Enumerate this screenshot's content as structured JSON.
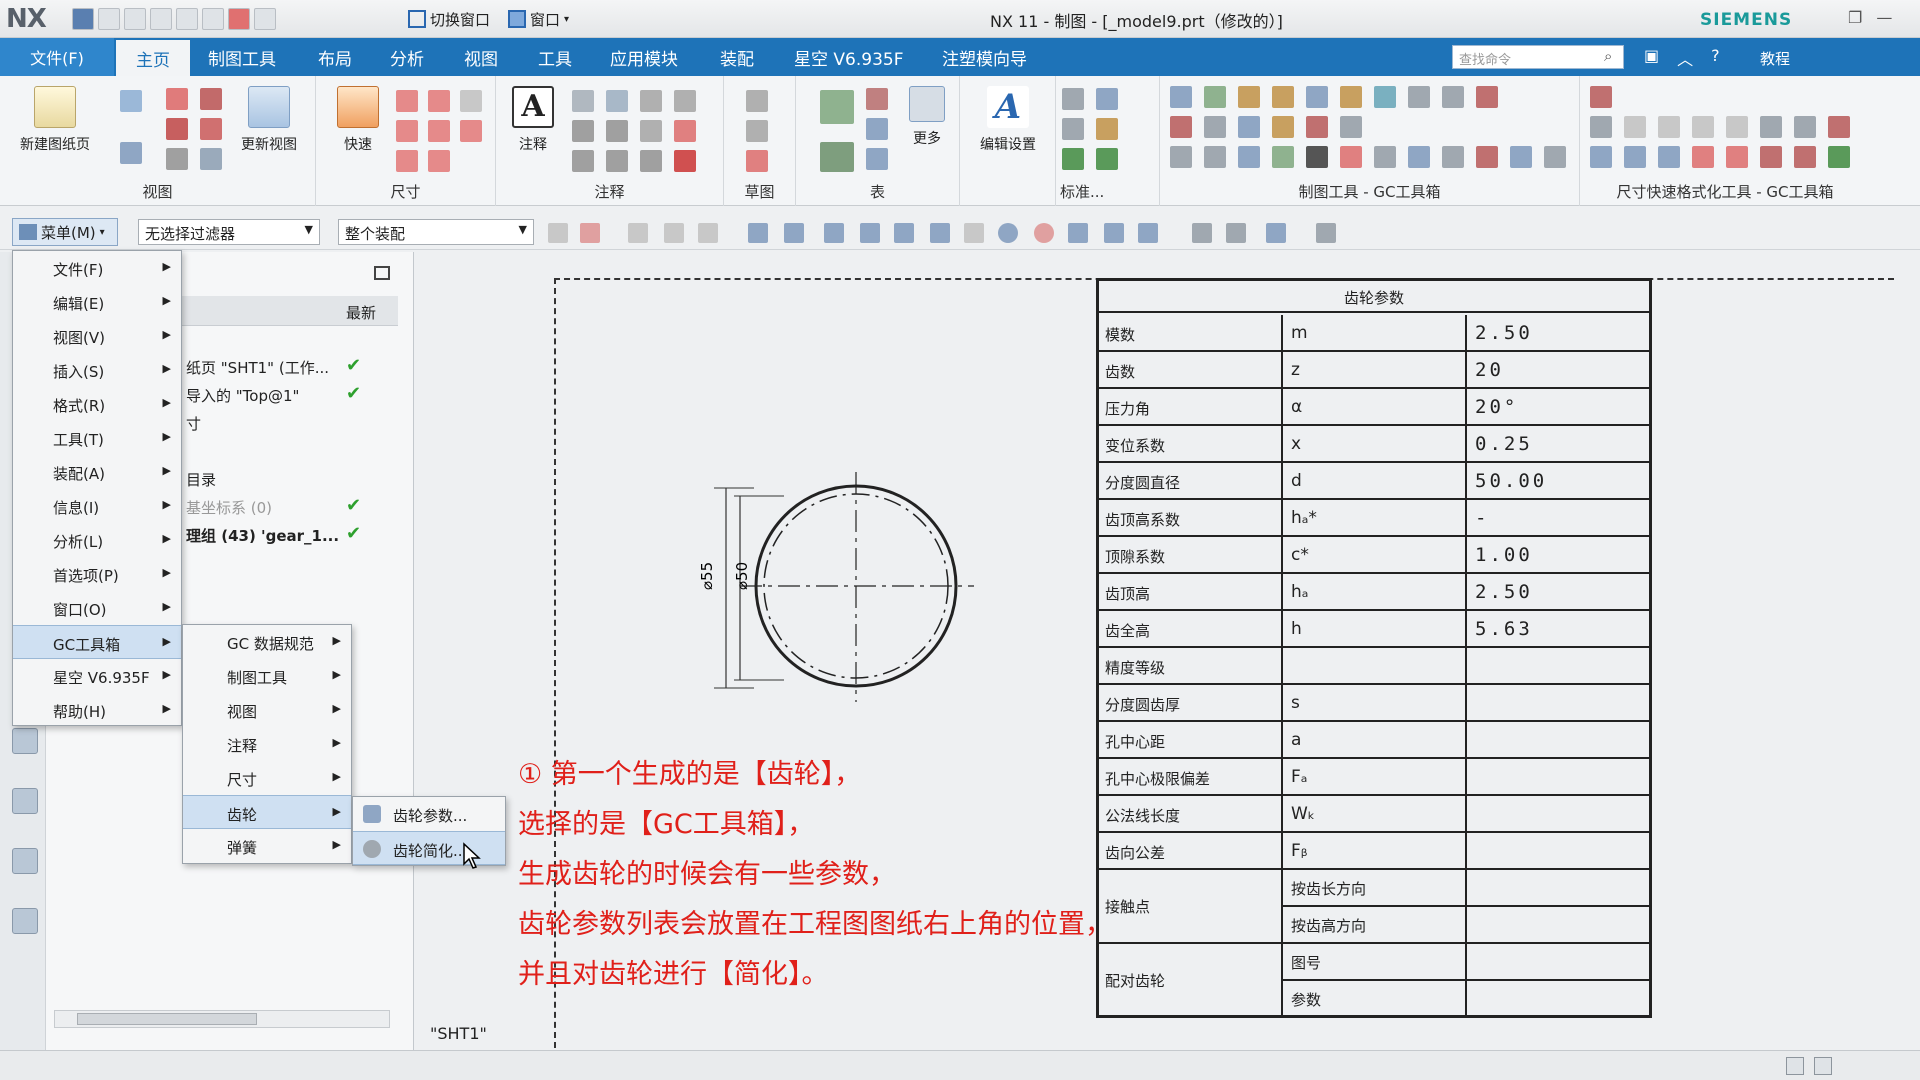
{
  "window": {
    "logo": "NX",
    "title": "NX 11 - 制图 - [_model9.prt（修改的）]",
    "brand": "SIEMENS",
    "switch_window": "切换窗口",
    "window_menu": "窗口"
  },
  "tabs": {
    "file": "文件(F)",
    "items": [
      "主页",
      "制图工具",
      "布局",
      "分析",
      "视图",
      "工具",
      "应用模块",
      "装配",
      "星空 V6.935F",
      "注塑模向导"
    ],
    "active": "主页",
    "search_placeholder": "查找命令",
    "help": "教程"
  },
  "ribbon": {
    "new_sheet": "新建图纸页",
    "update_views": "更新视图",
    "quick": "快速",
    "annotation": "注释",
    "more": "更多",
    "edit_settings": "编辑设置",
    "groups": [
      "视图",
      "尺寸",
      "注释",
      "草图",
      "表",
      "标准...",
      "制图工具 - GC工具箱",
      "尺寸快速格式化工具 - GC工具箱"
    ]
  },
  "toolbar": {
    "menu": "菜单(M)",
    "filter": "无选择过滤器",
    "scope": "整个装配"
  },
  "nav": {
    "col_latest": "最新",
    "rows": [
      {
        "text": "纸页 \"SHT1\" (工作...",
        "check": true
      },
      {
        "text": "导入的 \"Top@1\"",
        "check": true
      },
      {
        "text": "寸",
        "check": false
      },
      {
        "text": "",
        "check": false
      },
      {
        "text": "目录",
        "check": false
      },
      {
        "text": "基坐标系 (0)",
        "check": true
      },
      {
        "text": "理组 (43) 'gear_1...",
        "check": true
      }
    ]
  },
  "menu_main": {
    "items": [
      "文件(F)",
      "编辑(E)",
      "视图(V)",
      "插入(S)",
      "格式(R)",
      "工具(T)",
      "装配(A)",
      "信息(I)",
      "分析(L)",
      "首选项(P)",
      "窗口(O)",
      "GC工具箱",
      "星空 V6.935F",
      "帮助(H)"
    ],
    "highlighted": "GC工具箱"
  },
  "menu_gc": {
    "items": [
      "GC 数据规范",
      "制图工具",
      "视图",
      "注释",
      "尺寸",
      "齿轮",
      "弹簧"
    ],
    "highlighted": "齿轮"
  },
  "menu_gear": {
    "items": [
      "齿轮参数...",
      "齿轮简化..."
    ],
    "highlighted": "齿轮简化..."
  },
  "drawing": {
    "sheet_name": "\"SHT1\"",
    "dim_outer": "⌀55",
    "dim_inner": "⌀50"
  },
  "gear_table": {
    "title": "齿轮参数",
    "rows": [
      {
        "name": "模数",
        "symbol": "m",
        "value": "2.50"
      },
      {
        "name": "齿数",
        "symbol": "z",
        "value": "20"
      },
      {
        "name": "压力角",
        "symbol": "α",
        "value": "20°"
      },
      {
        "name": "变位系数",
        "symbol": "x",
        "value": "0.25"
      },
      {
        "name": "分度圆直径",
        "symbol": "d",
        "value": "50.00"
      },
      {
        "name": "齿顶高系数",
        "symbol": "hₐ*",
        "value": "-"
      },
      {
        "name": "顶隙系数",
        "symbol": "c*",
        "value": "1.00"
      },
      {
        "name": "齿顶高",
        "symbol": "hₐ",
        "value": "2.50"
      },
      {
        "name": "齿全高",
        "symbol": "h",
        "value": "5.63"
      },
      {
        "name": "精度等级",
        "symbol": "",
        "value": ""
      },
      {
        "name": "分度圆齿厚",
        "symbol": "s",
        "value": ""
      },
      {
        "name": "孔中心距",
        "symbol": "a",
        "value": ""
      },
      {
        "name": "孔中心极限偏差",
        "symbol": "Fₐ",
        "value": ""
      },
      {
        "name": "公法线长度",
        "symbol": "Wₖ",
        "value": ""
      },
      {
        "name": "齿向公差",
        "symbol": "Fᵦ",
        "value": ""
      }
    ],
    "contact": {
      "name": "接触点",
      "sub1": "按齿长方向",
      "sub2": "按齿高方向"
    },
    "mating": {
      "name": "配对齿轮",
      "sub1": "图号",
      "sub2": "参数"
    }
  },
  "annotation": {
    "lines": [
      "① 第一个生成的是【齿轮】，",
      "选择的是【GC工具箱】，",
      "生成齿轮的时候会有一些参数，",
      "齿轮参数列表会放置在工程图图纸右上角的位置，",
      "并且对齿轮进行【简化】。"
    ]
  }
}
